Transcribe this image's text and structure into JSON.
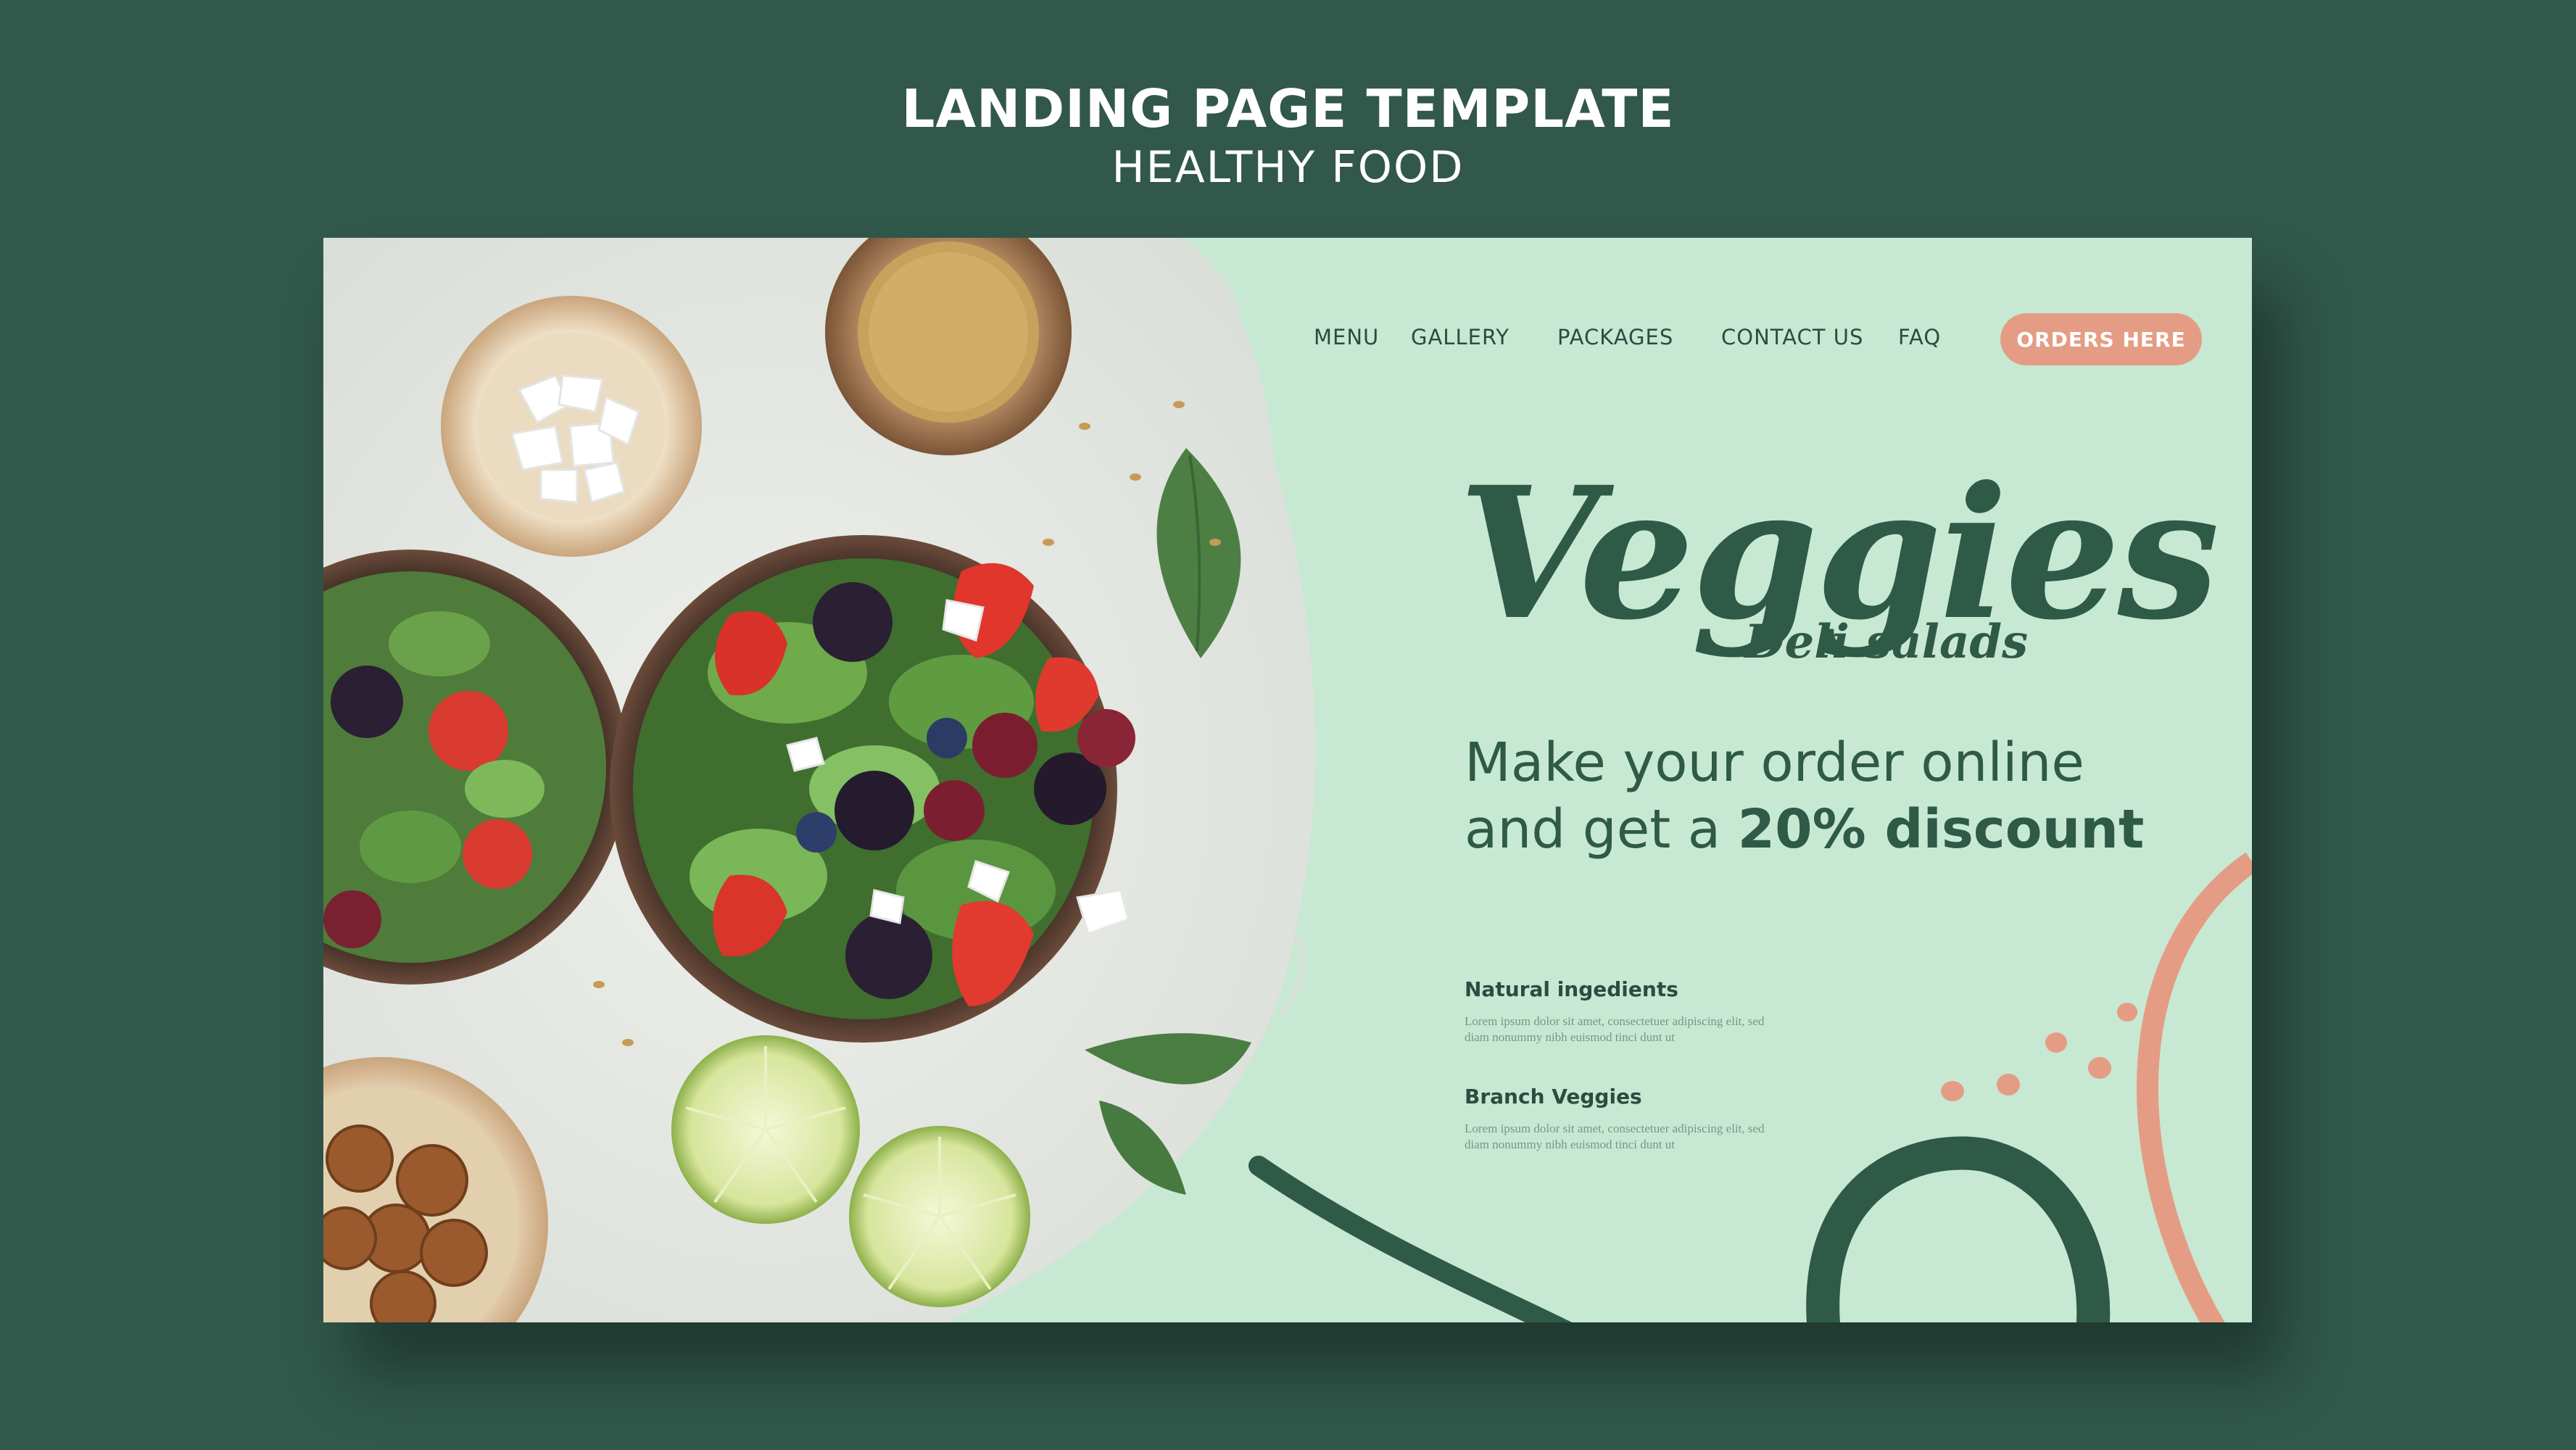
{
  "template": {
    "title": "LANDING PAGE TEMPLATE",
    "subtitle": "HEALTHY FOOD"
  },
  "nav": {
    "items": [
      "MENU",
      "GALLERY",
      "PACKAGES",
      "CONTACT US",
      "FAQ"
    ],
    "cta": "ORDERS HERE"
  },
  "hero": {
    "brand": "Veggies",
    "brand_sub": "Deli salads",
    "promo_line1": "Make your order online",
    "promo_line2_prefix": "and get a ",
    "promo_line2_bold": "20% discount"
  },
  "features": [
    {
      "title": "Natural ingedients",
      "body": "Lorem ipsum dolor sit amet, consectetuer adipiscing elit, sed diam nonummy nibh euismod tinci dunt ut"
    },
    {
      "title": "Branch Veggies",
      "body": "Lorem ipsum dolor sit amet, consectetuer adipiscing elit, sed diam nonummy nibh euismod tinci dunt ut"
    }
  ],
  "colors": {
    "background": "#31584a",
    "page": "#c7e9d4",
    "brand_green": "#2e5a47",
    "accent_salmon": "#e49d84"
  }
}
